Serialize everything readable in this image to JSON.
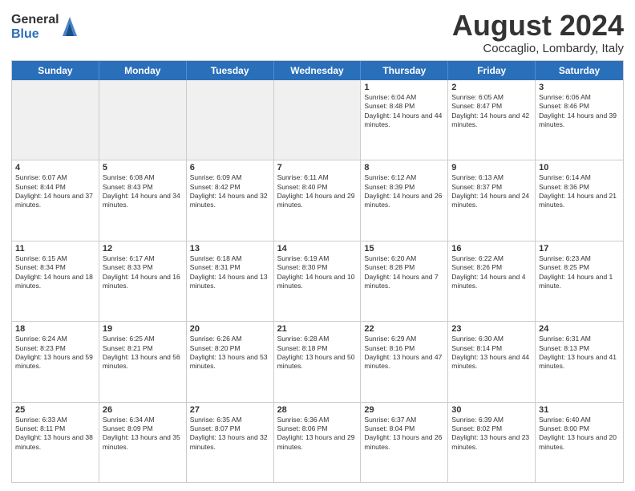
{
  "logo": {
    "general": "General",
    "blue": "Blue"
  },
  "title": {
    "month_year": "August 2024",
    "location": "Coccaglio, Lombardy, Italy"
  },
  "header_days": [
    "Sunday",
    "Monday",
    "Tuesday",
    "Wednesday",
    "Thursday",
    "Friday",
    "Saturday"
  ],
  "weeks": [
    [
      {
        "day": "",
        "info": "",
        "shaded": true
      },
      {
        "day": "",
        "info": "",
        "shaded": true
      },
      {
        "day": "",
        "info": "",
        "shaded": true
      },
      {
        "day": "",
        "info": "",
        "shaded": true
      },
      {
        "day": "1",
        "info": "Sunrise: 6:04 AM\nSunset: 8:48 PM\nDaylight: 14 hours and 44 minutes.",
        "shaded": false
      },
      {
        "day": "2",
        "info": "Sunrise: 6:05 AM\nSunset: 8:47 PM\nDaylight: 14 hours and 42 minutes.",
        "shaded": false
      },
      {
        "day": "3",
        "info": "Sunrise: 6:06 AM\nSunset: 8:46 PM\nDaylight: 14 hours and 39 minutes.",
        "shaded": false
      }
    ],
    [
      {
        "day": "4",
        "info": "Sunrise: 6:07 AM\nSunset: 8:44 PM\nDaylight: 14 hours and 37 minutes.",
        "shaded": false
      },
      {
        "day": "5",
        "info": "Sunrise: 6:08 AM\nSunset: 8:43 PM\nDaylight: 14 hours and 34 minutes.",
        "shaded": false
      },
      {
        "day": "6",
        "info": "Sunrise: 6:09 AM\nSunset: 8:42 PM\nDaylight: 14 hours and 32 minutes.",
        "shaded": false
      },
      {
        "day": "7",
        "info": "Sunrise: 6:11 AM\nSunset: 8:40 PM\nDaylight: 14 hours and 29 minutes.",
        "shaded": false
      },
      {
        "day": "8",
        "info": "Sunrise: 6:12 AM\nSunset: 8:39 PM\nDaylight: 14 hours and 26 minutes.",
        "shaded": false
      },
      {
        "day": "9",
        "info": "Sunrise: 6:13 AM\nSunset: 8:37 PM\nDaylight: 14 hours and 24 minutes.",
        "shaded": false
      },
      {
        "day": "10",
        "info": "Sunrise: 6:14 AM\nSunset: 8:36 PM\nDaylight: 14 hours and 21 minutes.",
        "shaded": false
      }
    ],
    [
      {
        "day": "11",
        "info": "Sunrise: 6:15 AM\nSunset: 8:34 PM\nDaylight: 14 hours and 18 minutes.",
        "shaded": false
      },
      {
        "day": "12",
        "info": "Sunrise: 6:17 AM\nSunset: 8:33 PM\nDaylight: 14 hours and 16 minutes.",
        "shaded": false
      },
      {
        "day": "13",
        "info": "Sunrise: 6:18 AM\nSunset: 8:31 PM\nDaylight: 14 hours and 13 minutes.",
        "shaded": false
      },
      {
        "day": "14",
        "info": "Sunrise: 6:19 AM\nSunset: 8:30 PM\nDaylight: 14 hours and 10 minutes.",
        "shaded": false
      },
      {
        "day": "15",
        "info": "Sunrise: 6:20 AM\nSunset: 8:28 PM\nDaylight: 14 hours and 7 minutes.",
        "shaded": false
      },
      {
        "day": "16",
        "info": "Sunrise: 6:22 AM\nSunset: 8:26 PM\nDaylight: 14 hours and 4 minutes.",
        "shaded": false
      },
      {
        "day": "17",
        "info": "Sunrise: 6:23 AM\nSunset: 8:25 PM\nDaylight: 14 hours and 1 minute.",
        "shaded": false
      }
    ],
    [
      {
        "day": "18",
        "info": "Sunrise: 6:24 AM\nSunset: 8:23 PM\nDaylight: 13 hours and 59 minutes.",
        "shaded": false
      },
      {
        "day": "19",
        "info": "Sunrise: 6:25 AM\nSunset: 8:21 PM\nDaylight: 13 hours and 56 minutes.",
        "shaded": false
      },
      {
        "day": "20",
        "info": "Sunrise: 6:26 AM\nSunset: 8:20 PM\nDaylight: 13 hours and 53 minutes.",
        "shaded": false
      },
      {
        "day": "21",
        "info": "Sunrise: 6:28 AM\nSunset: 8:18 PM\nDaylight: 13 hours and 50 minutes.",
        "shaded": false
      },
      {
        "day": "22",
        "info": "Sunrise: 6:29 AM\nSunset: 8:16 PM\nDaylight: 13 hours and 47 minutes.",
        "shaded": false
      },
      {
        "day": "23",
        "info": "Sunrise: 6:30 AM\nSunset: 8:14 PM\nDaylight: 13 hours and 44 minutes.",
        "shaded": false
      },
      {
        "day": "24",
        "info": "Sunrise: 6:31 AM\nSunset: 8:13 PM\nDaylight: 13 hours and 41 minutes.",
        "shaded": false
      }
    ],
    [
      {
        "day": "25",
        "info": "Sunrise: 6:33 AM\nSunset: 8:11 PM\nDaylight: 13 hours and 38 minutes.",
        "shaded": false
      },
      {
        "day": "26",
        "info": "Sunrise: 6:34 AM\nSunset: 8:09 PM\nDaylight: 13 hours and 35 minutes.",
        "shaded": false
      },
      {
        "day": "27",
        "info": "Sunrise: 6:35 AM\nSunset: 8:07 PM\nDaylight: 13 hours and 32 minutes.",
        "shaded": false
      },
      {
        "day": "28",
        "info": "Sunrise: 6:36 AM\nSunset: 8:06 PM\nDaylight: 13 hours and 29 minutes.",
        "shaded": false
      },
      {
        "day": "29",
        "info": "Sunrise: 6:37 AM\nSunset: 8:04 PM\nDaylight: 13 hours and 26 minutes.",
        "shaded": false
      },
      {
        "day": "30",
        "info": "Sunrise: 6:39 AM\nSunset: 8:02 PM\nDaylight: 13 hours and 23 minutes.",
        "shaded": false
      },
      {
        "day": "31",
        "info": "Sunrise: 6:40 AM\nSunset: 8:00 PM\nDaylight: 13 hours and 20 minutes.",
        "shaded": false
      }
    ]
  ]
}
